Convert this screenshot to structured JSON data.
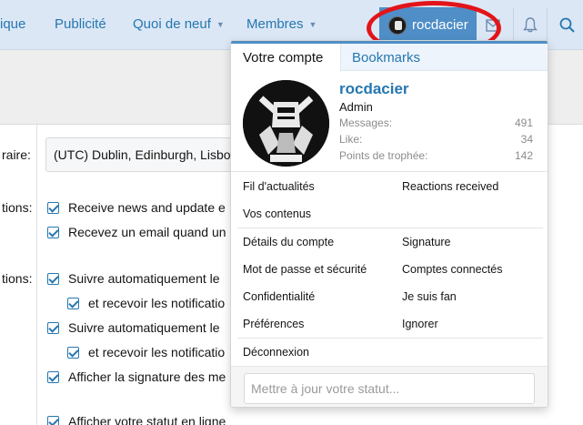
{
  "nav": {
    "items": [
      {
        "label": "ique"
      },
      {
        "label": "Publicité"
      },
      {
        "label": "Quoi de neuf"
      },
      {
        "label": "Membres"
      }
    ],
    "account_name": "rocdacier"
  },
  "form": {
    "rows": [
      {
        "label": "raire:"
      },
      {
        "label": "tions:"
      },
      {
        "label": "tions:"
      }
    ],
    "timezone_value": "(UTC) Dublin, Edinburgh, Lisbo",
    "checks": [
      {
        "label": "Receive news and update e"
      },
      {
        "label": "Recevez un email quand un"
      },
      {
        "label": "Suivre automatiquement le"
      },
      {
        "label": "et recevoir les notificatio"
      },
      {
        "label": "Suivre automatiquement le"
      },
      {
        "label": "et recevoir les notificatio"
      },
      {
        "label": "Afficher la signature des me"
      },
      {
        "label": "Afficher votre statut en ligne"
      }
    ]
  },
  "popup": {
    "tabs": [
      {
        "label": "Votre compte"
      },
      {
        "label": "Bookmarks"
      }
    ],
    "username": "rocdacier",
    "role": "Admin",
    "stats": [
      {
        "label": "Messages:",
        "value": "491"
      },
      {
        "label": "Like:",
        "value": "34"
      },
      {
        "label": "Points de trophée:",
        "value": "142"
      }
    ],
    "links_left": [
      "Fil d'actualités",
      "Vos contenus"
    ],
    "links_right": [
      "Reactions received"
    ],
    "account_left": [
      "Détails du compte",
      "Mot de passe et sécurité",
      "Confidentialité",
      "Préférences"
    ],
    "account_right": [
      "Signature",
      "Comptes connectés",
      "Je suis fan",
      "Ignorer"
    ],
    "logout": "Déconnexion",
    "status_placeholder": "Mettre à jour votre statut..."
  }
}
